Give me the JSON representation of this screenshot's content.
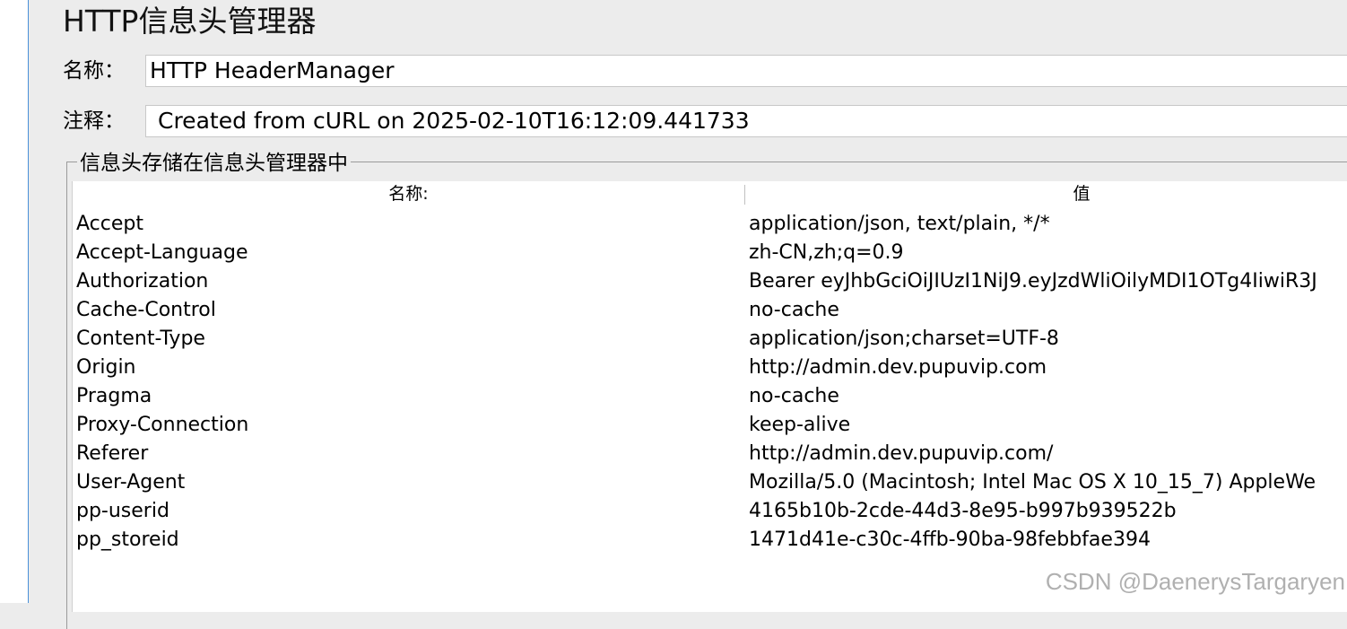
{
  "title": "HTTP信息头管理器",
  "name_field": {
    "label": "名称：",
    "value": "HTTP HeaderManager"
  },
  "comment_field": {
    "label": "注释：",
    "value": "Created from cURL on 2025-02-10T16:12:09.441733"
  },
  "group_title": "信息头存储在信息头管理器中",
  "table": {
    "columns": [
      "名称:",
      "值"
    ],
    "rows": [
      {
        "name": "Accept",
        "value": "application/json, text/plain, */*"
      },
      {
        "name": "Accept-Language",
        "value": "zh-CN,zh;q=0.9"
      },
      {
        "name": "Authorization",
        "value": "Bearer eyJhbGciOiJIUzI1NiJ9.eyJzdWliOilyMDI1OTg4IiwiR3J"
      },
      {
        "name": "Cache-Control",
        "value": "no-cache"
      },
      {
        "name": "Content-Type",
        "value": "application/json;charset=UTF-8"
      },
      {
        "name": "Origin",
        "value": "http://admin.dev.pupuvip.com"
      },
      {
        "name": "Pragma",
        "value": "no-cache"
      },
      {
        "name": "Proxy-Connection",
        "value": "keep-alive"
      },
      {
        "name": "Referer",
        "value": "http://admin.dev.pupuvip.com/"
      },
      {
        "name": "User-Agent",
        "value": "Mozilla/5.0 (Macintosh; Intel Mac OS X 10_15_7) AppleWe"
      },
      {
        "name": "pp-userid",
        "value": "4165b10b-2cde-44d3-8e95-b997b939522b"
      },
      {
        "name": "pp_storeid",
        "value": "1471d41e-c30c-4ffb-90ba-98febbfae394"
      }
    ]
  },
  "watermark": "CSDN @DaenerysTargaryen",
  "colors": {
    "background": "#ececec",
    "accent_border": "#4a90d9"
  }
}
